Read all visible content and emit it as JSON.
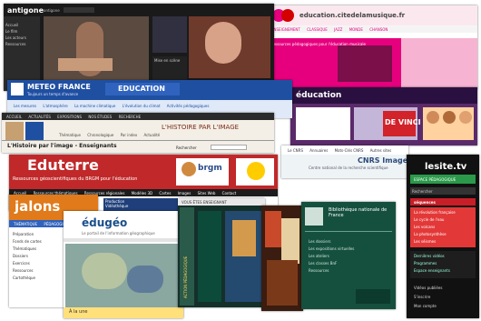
{
  "antigone": {
    "logo": "antigone",
    "logo_sub": "antigone",
    "nav": [
      "Accueil",
      "Le film",
      "Les acteurs",
      "Ressources"
    ],
    "caption": "Mise en scène"
  },
  "education_musique": {
    "title": "education.citedelamusique.fr",
    "tabs": [
      "ENSEIGNEMENT",
      "CLASSIQUE",
      "JAZZ",
      "MONDE",
      "CHANSON"
    ],
    "headline": "Ressources pédagogiques pour l'éducation musicale"
  },
  "meteo": {
    "brand": "METEO FRANCE",
    "slogan": "Toujours un temps d'avance",
    "section": "EDUCATION",
    "nav": [
      "Les mesures",
      "L'atmosphère",
      "La machine climatique",
      "L'évolution du climat",
      "Activités pédagogiques"
    ]
  },
  "education_channel": {
    "logo": "éducation",
    "banner": "DE VINCI"
  },
  "histoire_image": {
    "toolbar": [
      "ACCUEIL",
      "ACTUALITÉS",
      "EXPOSITIONS",
      "NOS ÉTUDES",
      "RECHERCHE"
    ],
    "title": "L'HISTOIRE PAR L'IMAGE",
    "tabs": [
      "Thématique",
      "Chronologique",
      "Par index",
      "Actualité"
    ],
    "page_title": "L'Histoire par l'image - Enseignants",
    "search": "Rechercher"
  },
  "cnrs": {
    "nav": [
      "Le CNRS",
      "Annuaires",
      "Mots-Clés CNRS",
      "Autres sites"
    ],
    "brand": "CNRS Images",
    "subtitle": "Centre national de la recherche scientifique"
  },
  "eduterre": {
    "title": "Eduterre",
    "subtitle": "Ressources géoscientifiques du BRGM pour l'éducation",
    "brgm": "brgm",
    "nav": [
      "Accueil",
      "Ressources thématiques",
      "Ressources régionales",
      "Modèles 3D",
      "Cartes",
      "Images",
      "Sites Web",
      "Contact"
    ],
    "menu": [
      "Production",
      "Vidéothèque",
      "Rendez-vous"
    ]
  },
  "lesite": {
    "brand": "lesite.tv",
    "subtitle": "ESPACE PÉDAGOGIQUE",
    "section": "séquences",
    "search": "Rechercher",
    "items": [
      "La révolution française",
      "Le cycle de l'eau",
      "Les volcans",
      "La photosynthèse",
      "Les séismes"
    ],
    "menu": [
      "Dernières vidéos",
      "Programmes",
      "Espace enseignants"
    ],
    "footer": [
      "Vidéos publiées",
      "S'inscrire",
      "Mon compte"
    ]
  },
  "jalons": {
    "logo": "jalons",
    "tabs": [
      "THÉMATIQUE",
      "PÉDAGOGIE"
    ],
    "items": [
      "Préparation",
      "Fonds de cartes",
      "Thématiques",
      "Dossiers",
      "Exercices",
      "Ressources",
      "Cartothèque"
    ]
  },
  "edugeo": {
    "logo": "édugéo",
    "subtitle": "Le portail de l'information géographique",
    "footer": "À la une"
  },
  "vous_etes_enseignant": {
    "header": "VOUS ÊTES ENSEIGNANT",
    "vertical": "ACTION PÉDAGOGIQUE"
  },
  "bnf": {
    "title": "Bibliothèque nationale de France",
    "items": [
      "Les dossiers",
      "Les expositions virtuelles",
      "Les ateliers",
      "Les classes BnF",
      "Ressources"
    ]
  },
  "colors": {
    "antigone_bg": "#1a1a1a",
    "meteo_blue": "#1f4fa0",
    "eduterre_red": "#c0282a",
    "lesite_green": "#2a9a4a",
    "jalons_orange": "#e07a1a",
    "bnf_green": "#15503e",
    "musique_pink": "#e6007e"
  }
}
